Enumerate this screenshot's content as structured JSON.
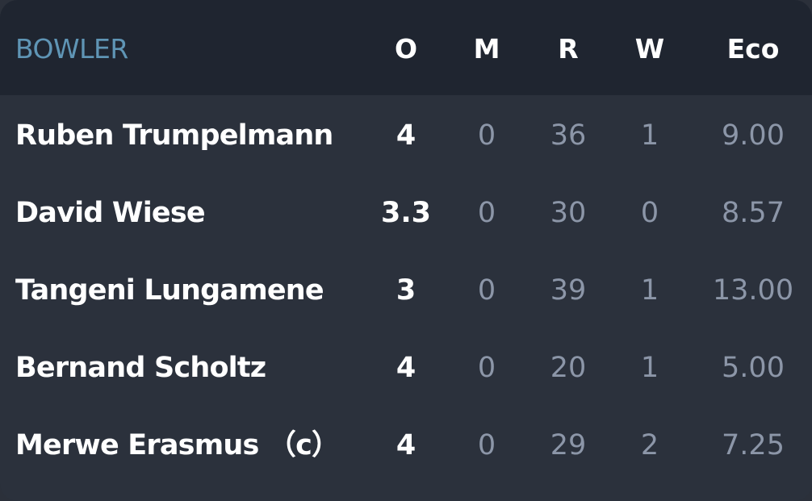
{
  "header": {
    "bowler": "BOWLER",
    "overs": "O",
    "maidens": "M",
    "runs": "R",
    "wickets": "W",
    "economy": "Eco"
  },
  "rows": [
    {
      "name": "Ruben Trumpelmann",
      "overs": "4",
      "maidens": "0",
      "runs": "36",
      "wickets": "1",
      "economy": "9.00"
    },
    {
      "name": "David Wiese",
      "overs": "3.3",
      "maidens": "0",
      "runs": "30",
      "wickets": "0",
      "economy": "8.57"
    },
    {
      "name": "Tangeni Lungamene",
      "overs": "3",
      "maidens": "0",
      "runs": "39",
      "wickets": "1",
      "economy": "13.00"
    },
    {
      "name": "Bernand Scholtz",
      "overs": "4",
      "maidens": "0",
      "runs": "20",
      "wickets": "1",
      "economy": "5.00"
    },
    {
      "name": "Merwe Erasmus （c）",
      "overs": "4",
      "maidens": "0",
      "runs": "29",
      "wickets": "2",
      "economy": "7.25"
    }
  ],
  "colors": {
    "background": "#2b313c",
    "header_background": "#1f2530",
    "bowler_header": "#5f95b5",
    "primary_text": "#ffffff",
    "muted_text": "#8c96a8"
  }
}
